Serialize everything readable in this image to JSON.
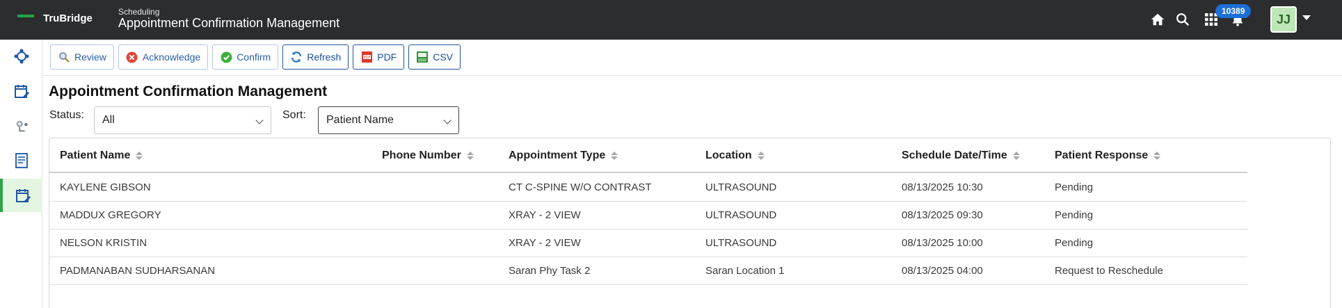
{
  "header": {
    "logo_text": "TruBridge",
    "app_subtitle": "Scheduling",
    "app_title": "Appointment Confirmation Management",
    "notification_count": "10389",
    "user_initials": "JJ"
  },
  "toolbar": {
    "review_label": "Review",
    "acknowledge_label": "Acknowledge",
    "confirm_label": "Confirm",
    "refresh_label": "Refresh",
    "pdf_label": "PDF",
    "csv_label": "CSV"
  },
  "page": {
    "title": "Appointment Confirmation Management"
  },
  "filters": {
    "status_label": "Status:",
    "status_value": "All",
    "sort_label": "Sort:",
    "sort_value": "Patient Name"
  },
  "table": {
    "columns": [
      "Patient Name",
      "Phone Number",
      "Appointment Type",
      "Location",
      "Schedule Date/Time",
      "Patient Response"
    ],
    "rows": [
      [
        "KAYLENE GIBSON",
        "",
        "CT C-SPINE W/O CONTRAST",
        "ULTRASOUND",
        "08/13/2025 10:30",
        "Pending"
      ],
      [
        "MADDUX GREGORY",
        "",
        "XRAY - 2 VIEW",
        "ULTRASOUND",
        "08/13/2025 09:30",
        "Pending"
      ],
      [
        "NELSON KRISTIN",
        "",
        "XRAY - 2 VIEW",
        "ULTRASOUND",
        "08/13/2025 10:00",
        "Pending"
      ],
      [
        "PADMANABAN SUDHARSANAN",
        "",
        "Saran Phy Task 2",
        "Saran Location 1",
        "08/13/2025 04:00",
        "Request to Reschedule"
      ]
    ]
  },
  "colors": {
    "topbar": "#2b2d2f",
    "accent_green": "#2fa24a",
    "toolbar_blue": "#1f55a6",
    "badge_blue": "#1d6fd6"
  },
  "icons": {
    "home": "home-icon",
    "search": "search-icon",
    "apps": "apps-grid-icon",
    "bell": "bell-icon"
  }
}
